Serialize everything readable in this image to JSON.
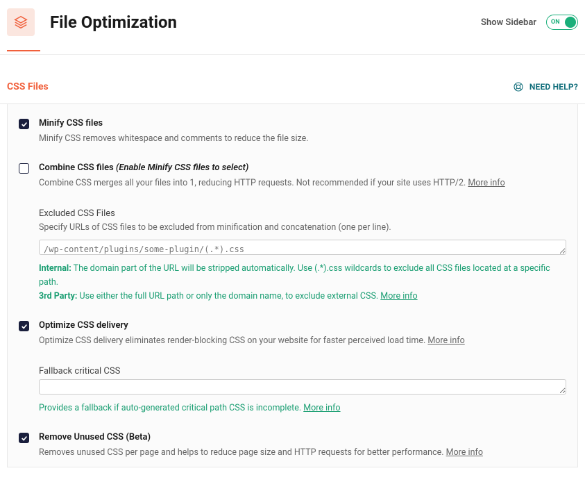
{
  "header": {
    "title": "File Optimization",
    "sidebar_label": "Show Sidebar",
    "toggle_text": "ON"
  },
  "section": {
    "title": "CSS Files",
    "help": "NEED HELP?"
  },
  "settings": {
    "minify": {
      "label": "Minify CSS files",
      "desc": "Minify CSS removes whitespace and comments to reduce the file size."
    },
    "combine": {
      "label": "Combine CSS files ",
      "hint": "(Enable Minify CSS files to select)",
      "desc": "Combine CSS merges all your files into 1, reducing HTTP requests. Not recommended if your site uses HTTP/2. ",
      "more": "More info"
    },
    "excluded": {
      "label": "Excluded CSS Files",
      "desc": "Specify URLs of CSS files to be excluded from minification and concatenation (one per line).",
      "placeholder": "/wp-content/plugins/some-plugin/(.*).css",
      "note_internal_label": "Internal:",
      "note_internal_text": " The domain part of the URL will be stripped automatically. Use (.*).css wildcards to exclude all CSS files located at a specific path.",
      "note_3rd_label": "3rd Party:",
      "note_3rd_text": " Use either the full URL path or only the domain name, to exclude external CSS. ",
      "note_more": "More info"
    },
    "optimize": {
      "label": "Optimize CSS delivery",
      "desc": "Optimize CSS delivery eliminates render-blocking CSS on your website for faster perceived load time. ",
      "more": "More info"
    },
    "fallback": {
      "label": "Fallback critical CSS",
      "note": "Provides a fallback if auto-generated critical path CSS is incomplete. ",
      "note_more": "More info"
    },
    "remove_unused": {
      "label": "Remove Unused CSS (Beta)",
      "desc": "Removes unused CSS per page and helps to reduce page size and HTTP requests for better performance. ",
      "more": "More info"
    }
  }
}
